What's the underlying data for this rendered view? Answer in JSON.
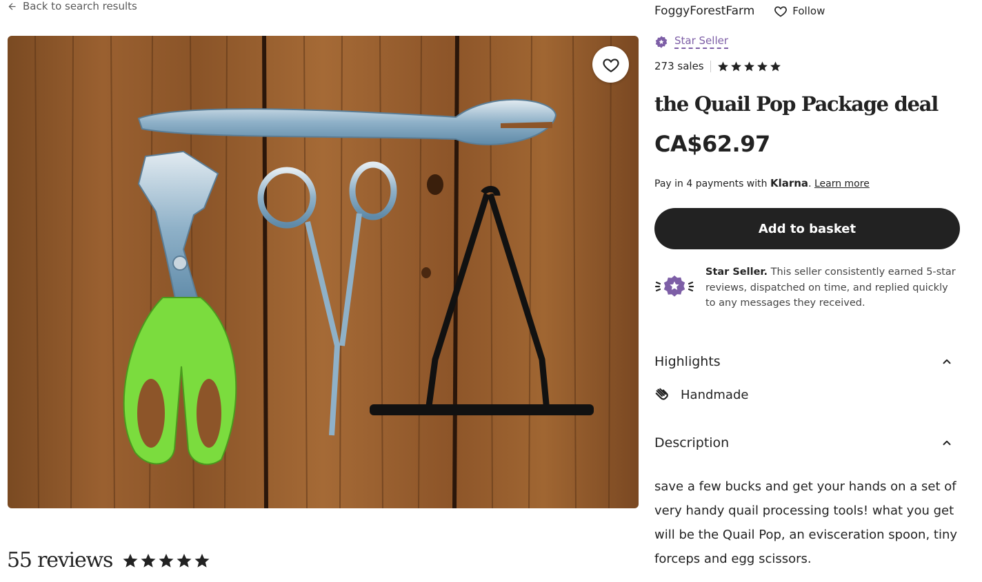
{
  "nav": {
    "back_label": "Back to search results"
  },
  "shop": {
    "name": "FoggyForestFarm",
    "follow_label": "Follow"
  },
  "star_seller": {
    "label": "Star Seller"
  },
  "sales": {
    "text": "273 sales",
    "rating_stars": 5
  },
  "listing": {
    "title": "the Quail Pop Package deal",
    "price": "CA$62.97",
    "photo_alt": "Quail processing tools on wooden board"
  },
  "payments": {
    "prefix": "Pay in 4 payments with ",
    "brand": "Klarna",
    "suffix": ".",
    "learn_more": "Learn more"
  },
  "cta": {
    "add_to_basket": "Add to basket"
  },
  "star_seller_info": {
    "bold": "Star Seller.",
    "text": " This seller consistently earned 5-star reviews, dispatched on time, and replied quickly to any messages they received."
  },
  "highlights": {
    "title": "Highlights",
    "items": [
      {
        "label": "Handmade",
        "icon": "hand-icon"
      }
    ]
  },
  "description": {
    "title": "Description",
    "body": "save a few bucks and get your hands on a set of very handy quail processing tools! what you get will be the Quail Pop, an evisceration spoon, tiny forceps and egg scissors."
  },
  "reviews": {
    "count_label": "55 reviews",
    "rating_stars": 5
  },
  "colors": {
    "accent_purple": "#7d5ea6",
    "button_dark": "#222222",
    "text": "#222222"
  }
}
